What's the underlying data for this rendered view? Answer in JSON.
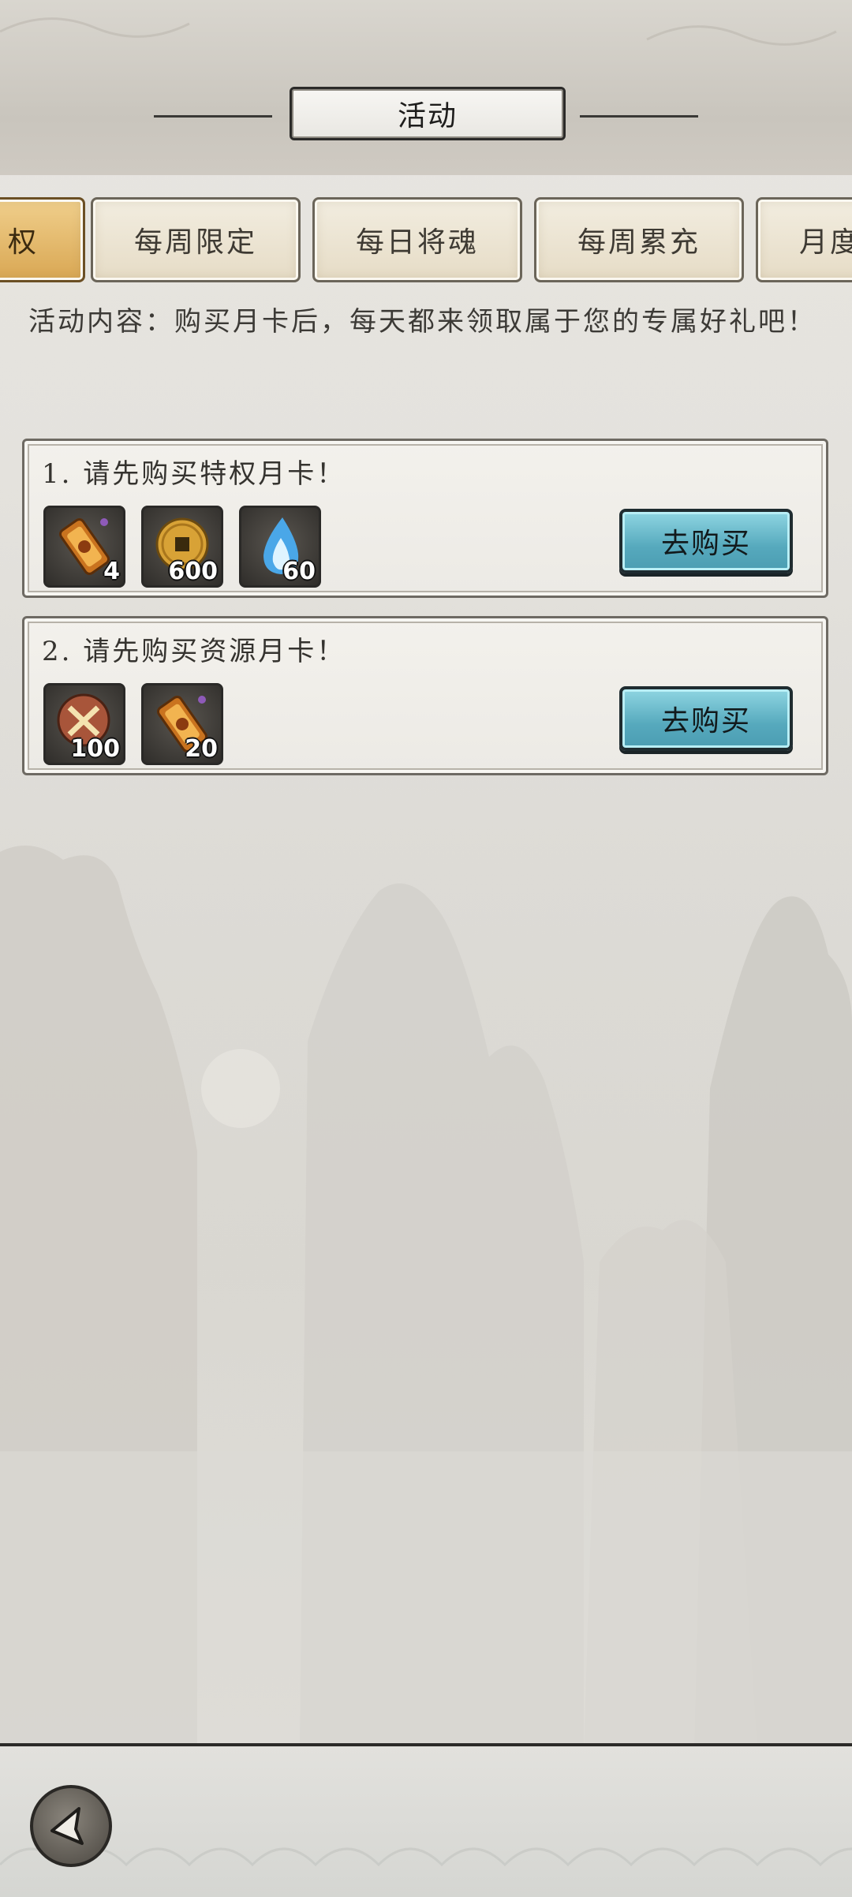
{
  "header": {
    "title": "活动"
  },
  "tabs": [
    {
      "label": "权",
      "active": true
    },
    {
      "label": "每周限定",
      "active": false
    },
    {
      "label": "每日将魂",
      "active": false
    },
    {
      "label": "每周累充",
      "active": false
    },
    {
      "label": "月度",
      "active": false
    }
  ],
  "description": "活动内容：购买月卡后，每天都来领取属于您的专属好礼吧！",
  "cards": [
    {
      "title": "1. 请先购买特权月卡！",
      "button": "去购买",
      "items": [
        {
          "icon": "scroll-token-icon",
          "count": "4"
        },
        {
          "icon": "copper-coin-icon",
          "count": "600"
        },
        {
          "icon": "blue-soul-flame-icon",
          "count": "60"
        }
      ]
    },
    {
      "title": "2. 请先购买资源月卡！",
      "button": "去购买",
      "items": [
        {
          "icon": "crossed-swords-badge-icon",
          "count": "100"
        },
        {
          "icon": "scroll-token-icon",
          "count": "20"
        }
      ]
    }
  ],
  "colors": {
    "accent_tab": "#d9a753",
    "buy_button": "#56a9bd"
  }
}
